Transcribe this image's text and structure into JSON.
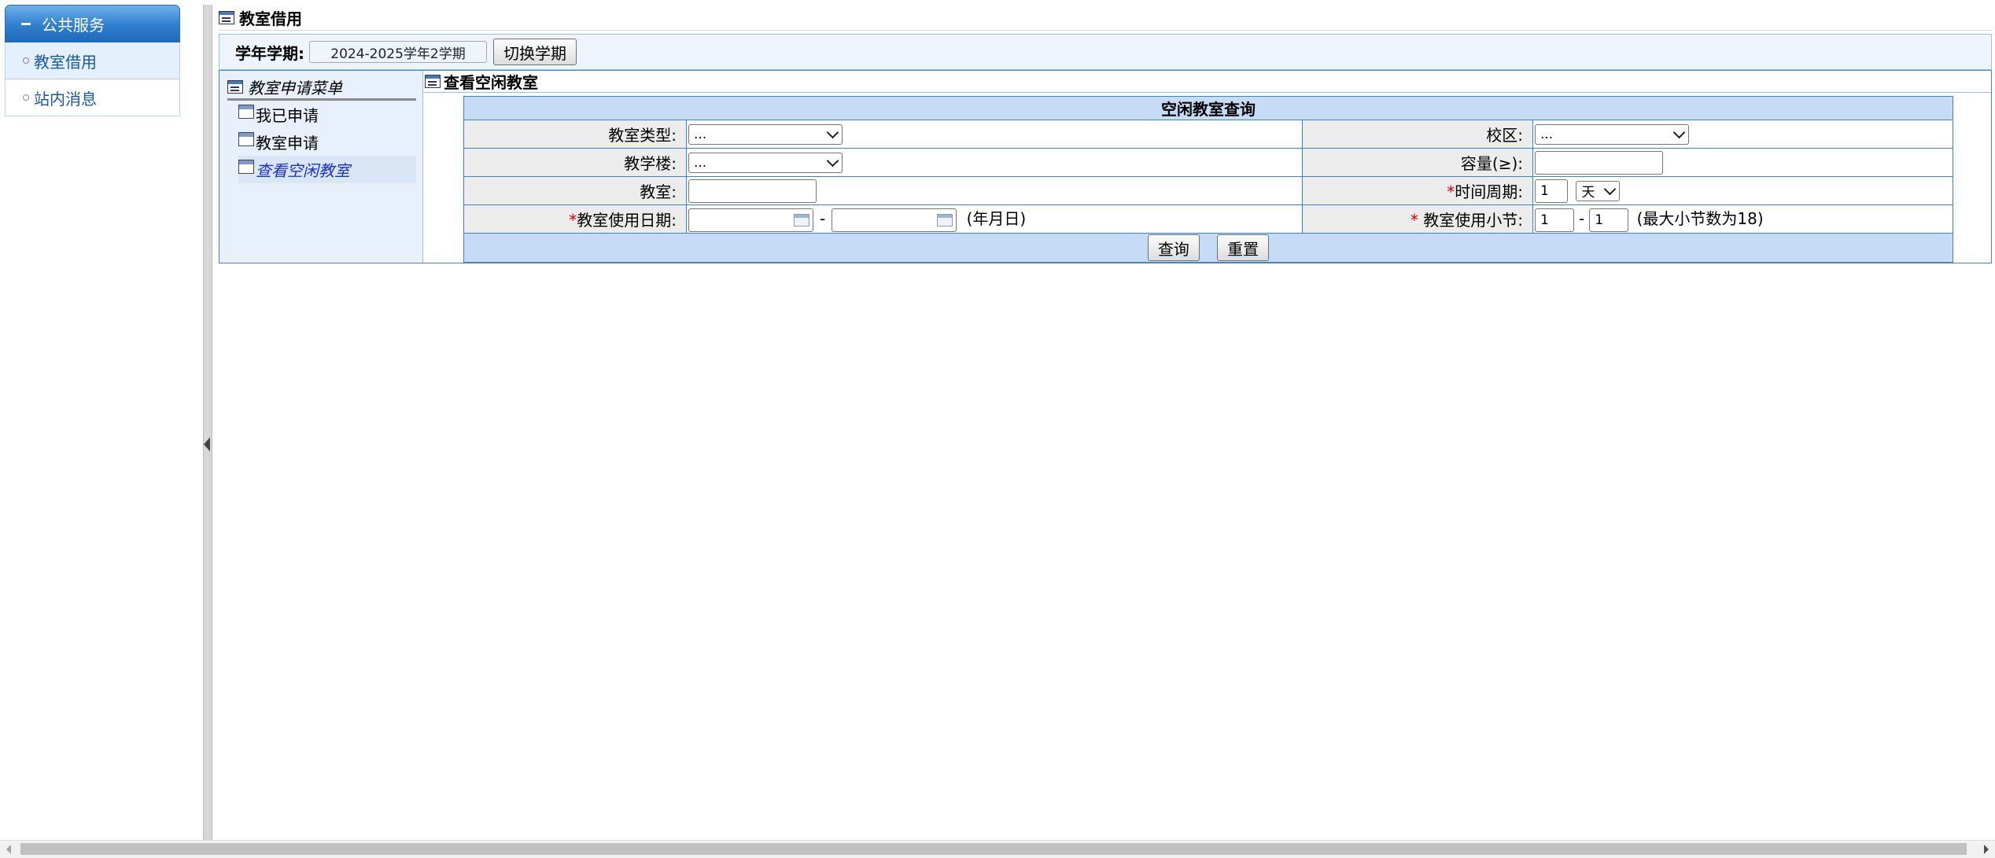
{
  "nav": {
    "header": "公共服务",
    "items": [
      {
        "label": "教室借用",
        "active": true
      },
      {
        "label": "站内消息",
        "active": false
      }
    ]
  },
  "page": {
    "title": "教室借用",
    "term_label": "学年学期:",
    "term_value": "2024-2025学年2学期",
    "switch_term_button": "切换学期"
  },
  "menu": {
    "title": "教室申请菜单",
    "items": [
      {
        "label": "我已申请",
        "selected": false
      },
      {
        "label": "教室申请",
        "selected": false
      },
      {
        "label": "查看空闲教室",
        "selected": true
      }
    ]
  },
  "panel": {
    "title": "查看空闲教室",
    "form_header": "空闲教室查询",
    "room_type_label": "教室类型:",
    "room_type_value": "...",
    "campus_label": "校区:",
    "campus_value": "...",
    "building_label": "教学楼:",
    "building_value": "...",
    "capacity_label": "容量(≥):",
    "capacity_value": "",
    "classroom_label": "教室:",
    "classroom_value": "",
    "required_mark": "*",
    "time_period_label": "时间周期:",
    "time_period_value": "1",
    "time_period_unit": "天",
    "date_label": "教室使用日期:",
    "date_from": "",
    "date_to": "",
    "date_dash": "-",
    "date_hint": "(年月日)",
    "section_label": " 教室使用小节:",
    "section_from": "1",
    "section_dash": "-",
    "section_to": "1",
    "section_hint": "(最大小节数为18)",
    "query_button": "查询",
    "reset_button": "重置"
  },
  "colors": {
    "nav_header": "#2f7fcf",
    "table_border": "#3a84cf",
    "table_header_bg": "#c6dcf6",
    "label_bg": "#ececec",
    "required": "#dd0000",
    "selected_link": "#1a2fd1"
  }
}
